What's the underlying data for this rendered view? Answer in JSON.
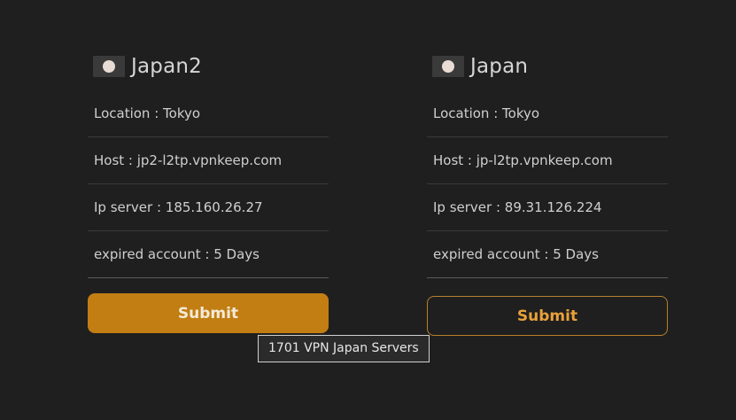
{
  "servers": [
    {
      "flag_icon": "japan-flag-icon",
      "title": "Japan2",
      "location": "Location : Tokyo",
      "host": "Host : jp2-l2tp.vpnkeep.com",
      "ip": "Ip server : 185.160.26.27",
      "expired": "expired account : 5 Days",
      "submit_label": "Submit",
      "accent": "#c27e13"
    },
    {
      "flag_icon": "japan-flag-icon",
      "title": "Japan",
      "location": "Location : Tokyo",
      "host": "Host : jp-l2tp.vpnkeep.com",
      "ip": "Ip server : 89.31.126.224",
      "expired": "expired account : 5 Days",
      "submit_label": "Submit",
      "accent": "#e8a13a"
    }
  ],
  "tooltip": "1701 VPN Japan Servers",
  "colors": {
    "background": "#1f1f1f",
    "button_fill": "#c27e13",
    "button_outline": "#b8802a"
  }
}
